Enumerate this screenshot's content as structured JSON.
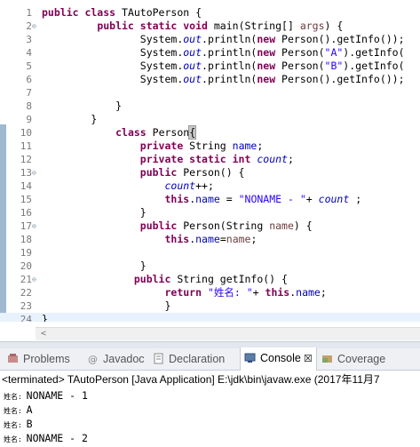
{
  "editor": {
    "lines": [
      {
        "n": "1",
        "parts": [
          [
            "kw",
            "public class "
          ],
          [
            "",
            "TAutoPerson {"
          ]
        ]
      },
      {
        "n": "2",
        "fold": true,
        "parts": [
          [
            "",
            "         "
          ],
          [
            "kw",
            "public static void "
          ],
          [
            "",
            "main(String[] "
          ],
          [
            "pm",
            "args"
          ],
          [
            "",
            ") {"
          ]
        ]
      },
      {
        "n": "3",
        "parts": [
          [
            "",
            "                System."
          ],
          [
            "fi",
            "out"
          ],
          [
            "",
            ".println("
          ],
          [
            "kw",
            "new "
          ],
          [
            "",
            "Person().getInfo());"
          ]
        ]
      },
      {
        "n": "4",
        "parts": [
          [
            "",
            "                System."
          ],
          [
            "fi",
            "out"
          ],
          [
            "",
            ".println("
          ],
          [
            "kw",
            "new "
          ],
          [
            "",
            "Person("
          ],
          [
            "st",
            "\"A\""
          ],
          [
            "",
            ").getInfo("
          ]
        ]
      },
      {
        "n": "5",
        "parts": [
          [
            "",
            "                System."
          ],
          [
            "fi",
            "out"
          ],
          [
            "",
            ".println("
          ],
          [
            "kw",
            "new "
          ],
          [
            "",
            "Person("
          ],
          [
            "st",
            "\"B\""
          ],
          [
            "",
            ").getInfo("
          ]
        ]
      },
      {
        "n": "6",
        "parts": [
          [
            "",
            "                System."
          ],
          [
            "fi",
            "out"
          ],
          [
            "",
            ".println("
          ],
          [
            "kw",
            "new "
          ],
          [
            "",
            "Person().getInfo());"
          ]
        ]
      },
      {
        "n": "7",
        "parts": []
      },
      {
        "n": "8",
        "parts": [
          [
            "",
            "            }"
          ]
        ]
      },
      {
        "n": "9",
        "parts": [
          [
            "",
            "        }"
          ]
        ]
      },
      {
        "n": "10",
        "parts": [
          [
            "",
            "            "
          ],
          [
            "kw",
            "class "
          ],
          [
            "",
            "Person"
          ],
          [
            "hl",
            "{"
          ]
        ]
      },
      {
        "n": "11",
        "parts": [
          [
            "",
            "                "
          ],
          [
            "kw",
            "private "
          ],
          [
            "",
            "String "
          ],
          [
            "fd",
            "name"
          ],
          [
            "",
            ";"
          ]
        ]
      },
      {
        "n": "12",
        "parts": [
          [
            "",
            "                "
          ],
          [
            "kw",
            "private static int "
          ],
          [
            "fi",
            "count"
          ],
          [
            "",
            ";"
          ]
        ]
      },
      {
        "n": "13",
        "fold": true,
        "parts": [
          [
            "",
            "                "
          ],
          [
            "kw",
            "public "
          ],
          [
            "",
            "Person() {"
          ]
        ]
      },
      {
        "n": "14",
        "parts": [
          [
            "",
            "                    "
          ],
          [
            "fi",
            "count"
          ],
          [
            "",
            "++;"
          ]
        ]
      },
      {
        "n": "15",
        "parts": [
          [
            "",
            "                    "
          ],
          [
            "kw",
            "this"
          ],
          [
            "",
            "."
          ],
          [
            "fd",
            "name"
          ],
          [
            "",
            " = "
          ],
          [
            "st",
            "\"NONAME - \""
          ],
          [
            "",
            "+ "
          ],
          [
            "fi",
            "count"
          ],
          [
            "",
            " ;"
          ]
        ]
      },
      {
        "n": "16",
        "parts": [
          [
            "",
            "                }"
          ]
        ]
      },
      {
        "n": "17",
        "fold": true,
        "parts": [
          [
            "",
            "                "
          ],
          [
            "kw",
            "public "
          ],
          [
            "",
            "Person(String "
          ],
          [
            "pm",
            "name"
          ],
          [
            "",
            ") {"
          ]
        ]
      },
      {
        "n": "18",
        "parts": [
          [
            "",
            "                    "
          ],
          [
            "kw",
            "this"
          ],
          [
            "",
            "."
          ],
          [
            "fd",
            "name"
          ],
          [
            "",
            "="
          ],
          [
            "pm",
            "name"
          ],
          [
            "",
            ";"
          ]
        ]
      },
      {
        "n": "19",
        "parts": []
      },
      {
        "n": "20",
        "parts": [
          [
            "",
            "                }"
          ]
        ]
      },
      {
        "n": "21",
        "fold": true,
        "parts": [
          [
            "",
            "               "
          ],
          [
            "kw",
            "public "
          ],
          [
            "",
            "String getInfo() {"
          ]
        ]
      },
      {
        "n": "22",
        "parts": [
          [
            "",
            "                    "
          ],
          [
            "kw",
            "return "
          ],
          [
            "st",
            "\"姓名: \""
          ],
          [
            "",
            "+ "
          ],
          [
            "kw",
            "this"
          ],
          [
            "",
            "."
          ],
          [
            "fd",
            "name"
          ],
          [
            "",
            ";"
          ]
        ]
      },
      {
        "n": "23",
        "parts": [
          [
            "",
            "                    }"
          ]
        ]
      },
      {
        "n": "24",
        "cur": true,
        "parts": [
          [
            "",
            "}"
          ]
        ]
      }
    ]
  },
  "tabs": [
    {
      "label": "Problems",
      "icon": "problems-icon",
      "active": false
    },
    {
      "label": "Javadoc",
      "icon": "javadoc-icon",
      "active": false
    },
    {
      "label": "Declaration",
      "icon": "declaration-icon",
      "active": false
    },
    {
      "label": "Console",
      "icon": "console-icon",
      "active": true,
      "close": "☒"
    },
    {
      "label": "Coverage",
      "icon": "coverage-icon",
      "active": false
    }
  ],
  "console": {
    "header": "<terminated> TAutoPerson [Java Application] E:\\jdk\\bin\\javaw.exe (2017年11月7",
    "output": [
      {
        "prefix": "姓名: ",
        "text": "NONAME - 1"
      },
      {
        "prefix": "姓名: ",
        "text": "A"
      },
      {
        "prefix": "姓名: ",
        "text": "B"
      },
      {
        "prefix": "姓名: ",
        "text": "NONAME - 2"
      }
    ]
  },
  "colors": {
    "keyword": "#7f0055",
    "string": "#2a00ff",
    "field": "#0000c0",
    "param": "#6a3e3e"
  }
}
